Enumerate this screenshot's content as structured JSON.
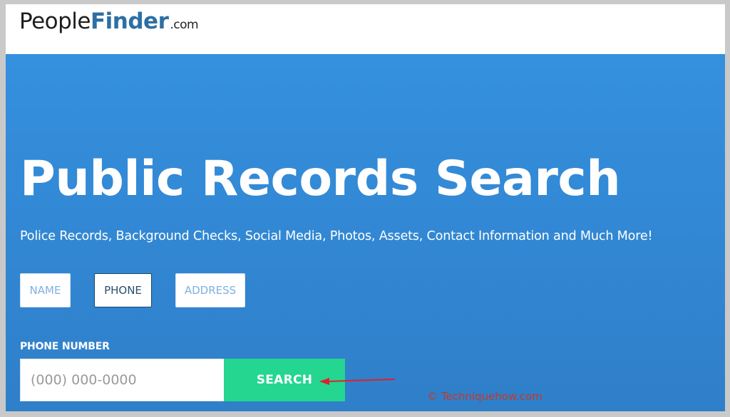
{
  "logo": {
    "part1": "People",
    "part2": "Finder",
    "part3": ".com"
  },
  "hero": {
    "title": "Public Records Search",
    "subtitle": "Police Records, Background Checks, Social Media, Photos, Assets, Contact Information and Much More!"
  },
  "tabs": [
    {
      "label": "NAME",
      "active": false
    },
    {
      "label": "PHONE",
      "active": true
    },
    {
      "label": "ADDRESS",
      "active": false
    }
  ],
  "form": {
    "label": "PHONE NUMBER",
    "placeholder": "(000) 000-0000",
    "value": "",
    "button_label": "SEARCH"
  },
  "annotation": {
    "arrow_color": "#e0202a"
  },
  "watermark": "© Techniquehow.com",
  "colors": {
    "hero_bg": "#3590de",
    "button": "#24d690",
    "logo_accent": "#2d6fa3",
    "watermark": "#c0392b"
  }
}
